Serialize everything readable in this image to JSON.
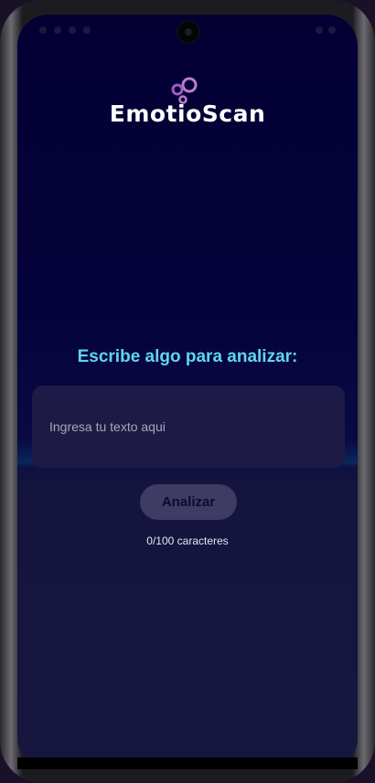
{
  "app": {
    "logo_text": "EmotioScan",
    "logo_icon": "bubbles-icon"
  },
  "main": {
    "heading": "Escribe algo para analizar:",
    "input_placeholder": "Ingresa tu texto aqui",
    "input_value": "",
    "analyze_button": "Analizar",
    "char_counter": "0/100 caracteres"
  },
  "colors": {
    "heading": "#5fd6ee",
    "background_top": "#040034",
    "input_bg": "#1d1a45",
    "button_bg": "#3e3c63",
    "logo_bubbles": "#b77ed0"
  }
}
